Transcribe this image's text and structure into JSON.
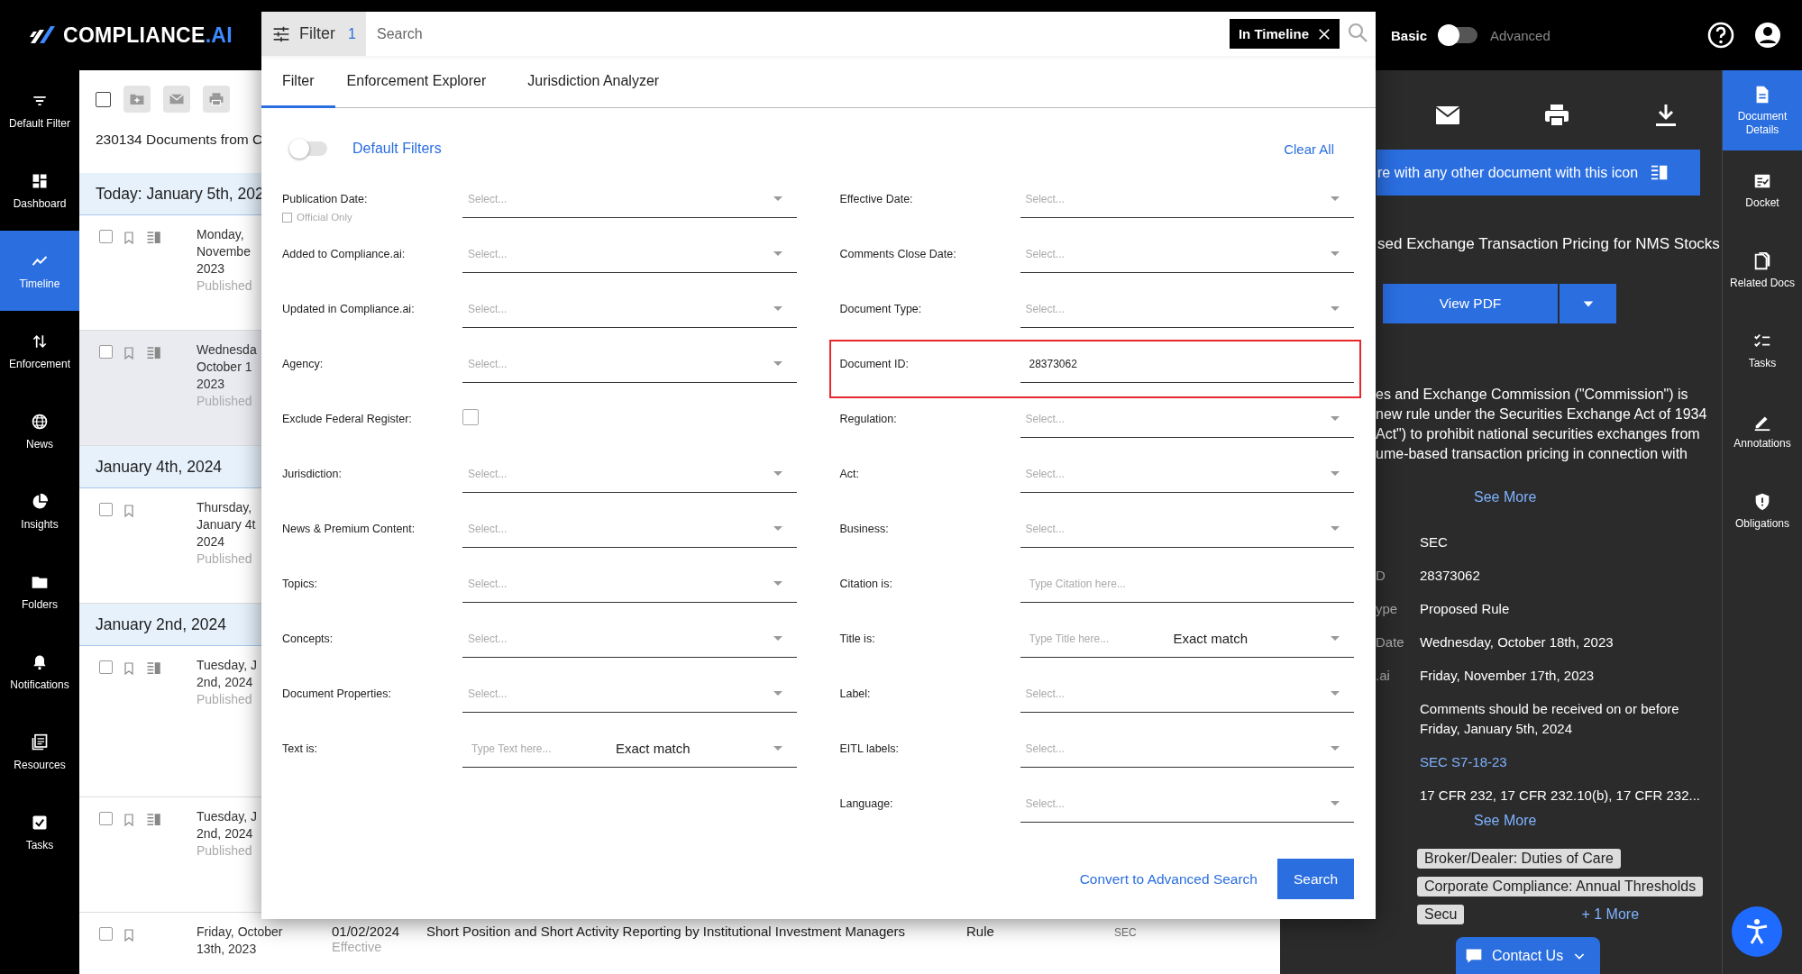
{
  "top_bar": {
    "logo_text": "COMPLIANCE",
    "logo_suffix": ".AI",
    "mode_toggle": {
      "left_label": "Basic",
      "right_label": "Advanced",
      "advanced": false
    }
  },
  "left_nav": [
    {
      "label": "Default Filter",
      "selected": false
    },
    {
      "label": "Dashboard",
      "selected": false
    },
    {
      "label": "Timeline",
      "selected": true
    },
    {
      "label": "Enforcement",
      "selected": false
    },
    {
      "label": "News",
      "selected": false
    },
    {
      "label": "Insights",
      "selected": false
    },
    {
      "label": "Folders",
      "selected": false
    },
    {
      "label": "Notifications",
      "selected": false
    },
    {
      "label": "Resources",
      "selected": false
    },
    {
      "label": "Tasks",
      "selected": false
    }
  ],
  "document_list": {
    "select_all_checked": false,
    "count_text": "230134 Documents from C",
    "groups": [
      {
        "heading": "Today: January 5th, 202",
        "rows": [
          {
            "date_lines": [
              "Monday,",
              "Novembe",
              "2023"
            ],
            "status": "Published",
            "checked": false,
            "compare": true,
            "selected": false
          },
          {
            "date_lines": [
              "Wednesda",
              "October 1",
              "2023"
            ],
            "status": "Published",
            "checked": false,
            "compare": true,
            "selected": true
          }
        ]
      },
      {
        "heading": "January 4th, 2024",
        "rows": [
          {
            "date_lines": [
              "Thursday,",
              "January 4t",
              "2024"
            ],
            "status": "Published",
            "checked": false,
            "compare": false,
            "selected": false
          }
        ]
      },
      {
        "heading": "January 2nd, 2024",
        "rows": [
          {
            "date_lines": [
              "Tuesday, J",
              "2nd, 2024"
            ],
            "status": "Published",
            "checked": false,
            "compare": true,
            "selected": false
          },
          {
            "date_lines": [
              "Tuesday, J",
              "2nd, 2024"
            ],
            "status": "Published",
            "checked": false,
            "compare": true,
            "selected": false
          },
          {
            "date_lines": [
              "Friday, October",
              "13th, 2023"
            ],
            "checked": false,
            "compare": false,
            "selected": false,
            "effective_date": "01/02/2024",
            "effective_label": "Effective",
            "title": "Short Position and Short Activity Reporting by Institutional Investment Managers",
            "doc_type": "Rule",
            "agency": "SEC"
          }
        ]
      }
    ]
  },
  "filter_panel": {
    "filter_button": {
      "label": "Filter",
      "count": "1"
    },
    "search": {
      "placeholder": "Search"
    },
    "scope_chip": "In Timeline",
    "tabs": [
      {
        "label": "Filter",
        "selected": true
      },
      {
        "label": "Enforcement Explorer",
        "selected": false
      },
      {
        "label": "Jurisdiction Analyzer",
        "selected": false
      }
    ],
    "default_filters": {
      "label": "Default Filters",
      "on": false
    },
    "clear_all": "Clear All",
    "left_fields": [
      {
        "kind": "select",
        "label": "Publication Date:",
        "placeholder": "Select...",
        "highlighted": false,
        "option": {
          "label": "Official Only",
          "checked": false
        }
      },
      {
        "kind": "select",
        "label": "Added to Compliance.ai:",
        "placeholder": "Select...",
        "highlighted": false
      },
      {
        "kind": "select",
        "label": "Updated in Compliance.ai:",
        "placeholder": "Select...",
        "highlighted": false
      },
      {
        "kind": "select",
        "label": "Agency:",
        "placeholder": "Select...",
        "highlighted": false
      },
      {
        "kind": "checkbox",
        "label": "Exclude Federal Register:",
        "checked": false,
        "highlighted": false
      },
      {
        "kind": "select",
        "label": "Jurisdiction:",
        "placeholder": "Select...",
        "highlighted": false
      },
      {
        "kind": "select",
        "label": "News & Premium Content:",
        "placeholder": "Select...",
        "highlighted": false
      },
      {
        "kind": "select",
        "label": "Topics:",
        "placeholder": "Select...",
        "highlighted": false
      },
      {
        "kind": "select",
        "label": "Concepts:",
        "placeholder": "Select...",
        "highlighted": false
      },
      {
        "kind": "select",
        "label": "Document Properties:",
        "placeholder": "Select...",
        "highlighted": false
      },
      {
        "kind": "match",
        "label": "Text is:",
        "placeholder": "Type Text here...",
        "match": "Exact match",
        "highlighted": false
      }
    ],
    "right_fields": [
      {
        "kind": "select",
        "label": "Effective Date:",
        "placeholder": "Select...",
        "highlighted": false
      },
      {
        "kind": "select",
        "label": "Comments Close Date:",
        "placeholder": "Select...",
        "highlighted": false
      },
      {
        "kind": "select",
        "label": "Document Type:",
        "placeholder": "Select...",
        "highlighted": false
      },
      {
        "kind": "text",
        "label": "Document ID:",
        "value": "28373062",
        "highlighted": true
      },
      {
        "kind": "select",
        "label": "Regulation:",
        "placeholder": "Select...",
        "highlighted": false
      },
      {
        "kind": "select",
        "label": "Act:",
        "placeholder": "Select...",
        "highlighted": false
      },
      {
        "kind": "select",
        "label": "Business:",
        "placeholder": "Select...",
        "highlighted": false
      },
      {
        "kind": "text",
        "label": "Citation is:",
        "placeholder": "Type Citation here...",
        "highlighted": false
      },
      {
        "kind": "match",
        "label": "Title is:",
        "placeholder": "Type Title here...",
        "match": "Exact match",
        "highlighted": false
      },
      {
        "kind": "select",
        "label": "Label:",
        "placeholder": "Select...",
        "highlighted": false
      },
      {
        "kind": "select",
        "label": "EITL labels:",
        "placeholder": "Select...",
        "highlighted": false
      },
      {
        "kind": "select",
        "label": "Language:",
        "placeholder": "Select...",
        "highlighted": false
      }
    ],
    "convert_link": "Convert to Advanced Search",
    "search_button": "Search"
  },
  "detail_panel": {
    "compare_banner": "re with any other document with this icon",
    "title": "sed Exchange Transaction Pricing for NMS Stocks",
    "view_pdf": "View PDF",
    "summary_lines": [
      "es and Exchange Commission (\"Commission\") is",
      "new rule under the Securities Exchange Act of 1934",
      "Act\") to prohibit national securities exchanges from",
      "ume-based transaction pricing in connection with"
    ],
    "see_more": "See More",
    "meta": [
      {
        "value": "SEC"
      },
      {
        "label": "D",
        "value": "28373062"
      },
      {
        "label": "ype",
        "value": "Proposed Rule"
      },
      {
        "label": "Date",
        "value": "Wednesday, October 18th, 2023"
      },
      {
        "label": ".ai",
        "value": "Friday, November 17th, 2023"
      },
      {
        "value": "Comments should be received on or before Friday, January 5th, 2024"
      },
      {
        "kind": "link",
        "value": "SEC S7-18-23"
      },
      {
        "value": "17 CFR 232, 17 CFR 232.10(b), 17 CFR 232..."
      }
    ],
    "see_more_2": "See More",
    "tags": [
      "Broker/Dealer: Duties of Care",
      "Corporate Compliance: Annual Thresholds",
      "Secu"
    ],
    "more_tags": "+ 1 More"
  },
  "right_rail": [
    {
      "label": "Document Details",
      "selected": true
    },
    {
      "label": "Docket",
      "selected": false
    },
    {
      "label": "Related Docs",
      "selected": false
    },
    {
      "label": "Tasks",
      "selected": false
    },
    {
      "label": "Annotations",
      "selected": false
    },
    {
      "label": "Obligations",
      "selected": false
    }
  ],
  "contact_button": "Contact Us"
}
